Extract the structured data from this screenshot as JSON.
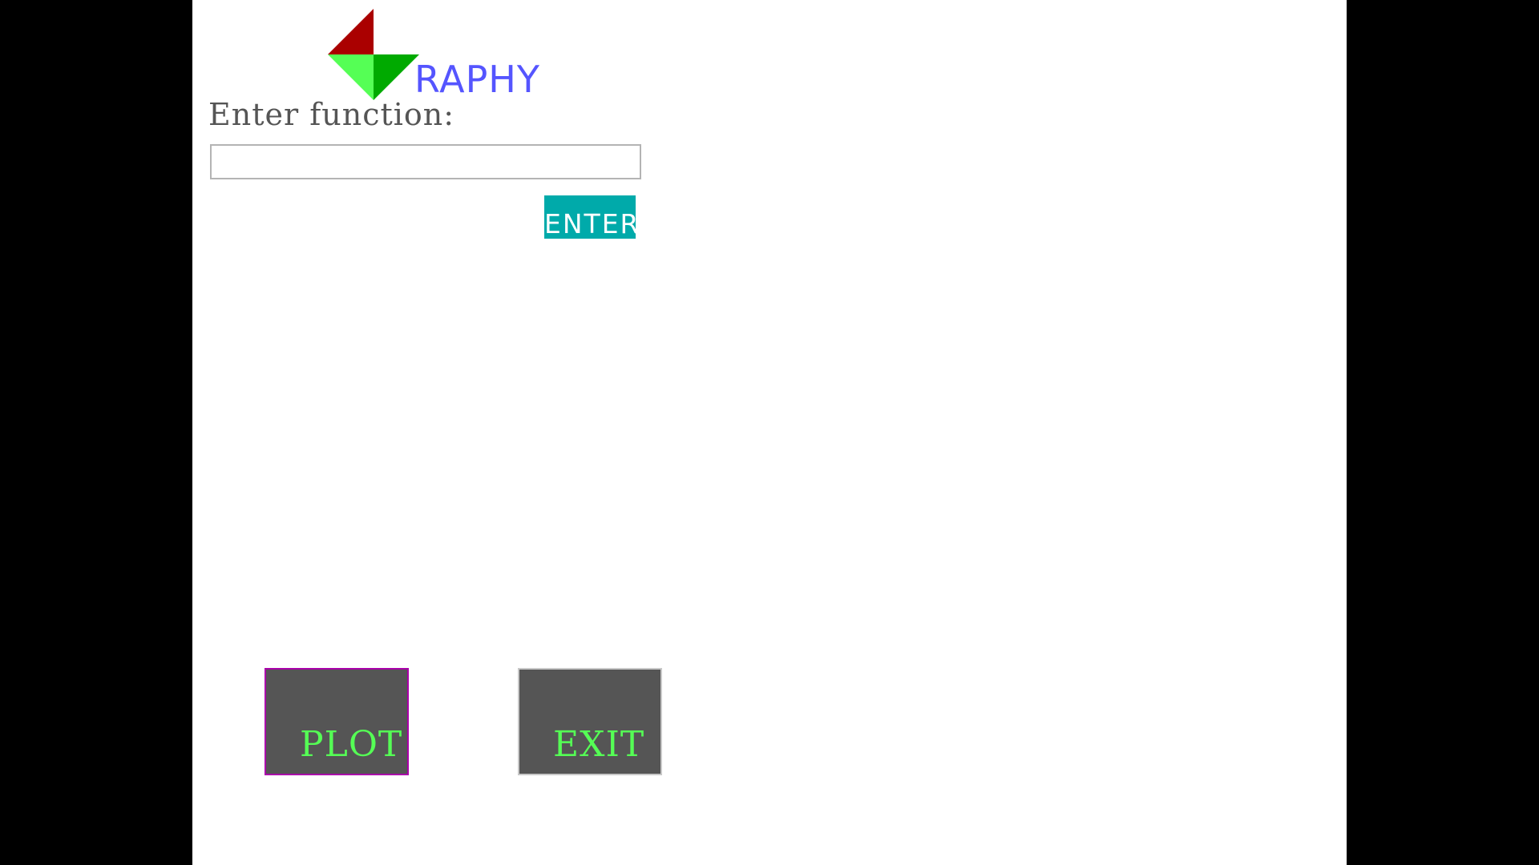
{
  "logo": {
    "text": "RAPHY",
    "icon": "graphy-g-logo-icon",
    "colors": {
      "dark_red": "#aa0000",
      "light_green": "#55ff55",
      "dark_green": "#00aa00",
      "text_blue": "#5555ff"
    }
  },
  "prompt": {
    "label": "Enter function:"
  },
  "function_input": {
    "value": "",
    "placeholder": ""
  },
  "enter_button": {
    "label": "ENTER",
    "color": "#00aaaa"
  },
  "actions": {
    "plot_label": "PLOT",
    "exit_label": "EXIT",
    "button_color": "#555555",
    "label_color": "#55ff55",
    "plot_border_color": "#aa00aa"
  }
}
